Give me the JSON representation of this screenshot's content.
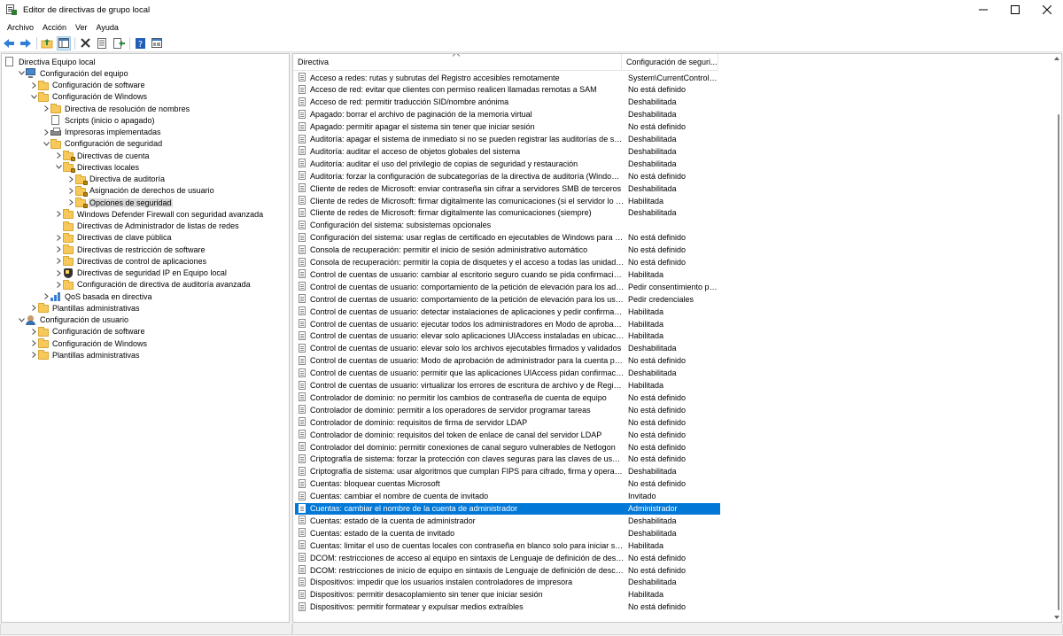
{
  "window": {
    "title": "Editor de directivas de grupo local"
  },
  "menu": [
    "Archivo",
    "Acción",
    "Ver",
    "Ayuda"
  ],
  "toolbar": {
    "icons": [
      "back-arrow-icon",
      "forward-arrow-icon",
      "up-folder-icon",
      "show-hide-tree-icon",
      "delete-icon",
      "properties-icon",
      "export-list-icon",
      "help-icon",
      "console-view-icon"
    ]
  },
  "tree": [
    {
      "label": "Directiva Equipo local",
      "indent": 0,
      "arrow": "",
      "icon": "doc"
    },
    {
      "label": "Configuración del equipo",
      "indent": 1,
      "arrow": "open",
      "icon": "computer"
    },
    {
      "label": "Configuración de software",
      "indent": 2,
      "arrow": "closed",
      "icon": "folder"
    },
    {
      "label": "Configuración de Windows",
      "indent": 2,
      "arrow": "open",
      "icon": "folder"
    },
    {
      "label": "Directiva de resolución de nombres",
      "indent": 3,
      "arrow": "closed",
      "icon": "folder"
    },
    {
      "label": "Scripts (inicio o apagado)",
      "indent": 3,
      "arrow": "",
      "icon": "doc"
    },
    {
      "label": "Impresoras implementadas",
      "indent": 3,
      "arrow": "closed",
      "icon": "printer"
    },
    {
      "label": "Configuración de seguridad",
      "indent": 3,
      "arrow": "open",
      "icon": "folder"
    },
    {
      "label": "Directivas de cuenta",
      "indent": 4,
      "arrow": "closed",
      "icon": "folder-lock"
    },
    {
      "label": "Directivas locales",
      "indent": 4,
      "arrow": "open",
      "icon": "folder-lock"
    },
    {
      "label": "Directiva de auditoría",
      "indent": 5,
      "arrow": "closed",
      "icon": "folder-lock"
    },
    {
      "label": "Asignación de derechos de usuario",
      "indent": 5,
      "arrow": "closed",
      "icon": "folder-lock"
    },
    {
      "label": "Opciones de seguridad",
      "indent": 5,
      "arrow": "closed",
      "icon": "folder-lock",
      "selected": true
    },
    {
      "label": "Windows Defender Firewall con seguridad avanzada",
      "indent": 4,
      "arrow": "closed",
      "icon": "folder"
    },
    {
      "label": "Directivas de Administrador de listas de redes",
      "indent": 4,
      "arrow": "",
      "icon": "folder"
    },
    {
      "label": "Directivas de clave pública",
      "indent": 4,
      "arrow": "closed",
      "icon": "folder"
    },
    {
      "label": "Directivas de restricción de software",
      "indent": 4,
      "arrow": "closed",
      "icon": "folder"
    },
    {
      "label": "Directivas de control de aplicaciones",
      "indent": 4,
      "arrow": "closed",
      "icon": "folder"
    },
    {
      "label": "Directivas de seguridad IP en Equipo local",
      "indent": 4,
      "arrow": "closed",
      "icon": "shield"
    },
    {
      "label": "Configuración de directiva de auditoría avanzada",
      "indent": 4,
      "arrow": "closed",
      "icon": "folder"
    },
    {
      "label": "QoS basada en directiva",
      "indent": 3,
      "arrow": "closed",
      "icon": "chart"
    },
    {
      "label": "Plantillas administrativas",
      "indent": 2,
      "arrow": "closed",
      "icon": "folder"
    },
    {
      "label": "Configuración de usuario",
      "indent": 1,
      "arrow": "open",
      "icon": "user"
    },
    {
      "label": "Configuración de software",
      "indent": 2,
      "arrow": "closed",
      "icon": "folder"
    },
    {
      "label": "Configuración de Windows",
      "indent": 2,
      "arrow": "closed",
      "icon": "folder"
    },
    {
      "label": "Plantillas administrativas",
      "indent": 2,
      "arrow": "closed",
      "icon": "folder"
    }
  ],
  "list": {
    "columns": [
      "Directiva",
      "Configuración de seguri..."
    ],
    "rows": [
      {
        "policy": "Acceso a redes: rutas y subrutas del Registro accesibles remotamente",
        "setting": "System\\CurrentControlS..."
      },
      {
        "policy": "Acceso de red: evitar que clientes con permiso realicen llamadas remotas a SAM",
        "setting": "No está definido"
      },
      {
        "policy": "Acceso de red: permitir traducción SID/nombre anónima",
        "setting": "Deshabilitada"
      },
      {
        "policy": "Apagado: borrar el archivo de paginación de la memoria virtual",
        "setting": "Deshabilitada"
      },
      {
        "policy": "Apagado: permitir apagar el sistema sin tener que iniciar sesión",
        "setting": "No está definido"
      },
      {
        "policy": "Auditoría: apagar el sistema de inmediato si no se pueden registrar las auditorías de seguri...",
        "setting": "Deshabilitada"
      },
      {
        "policy": "Auditoría: auditar el acceso de objetos globales del sistema",
        "setting": "Deshabilitada"
      },
      {
        "policy": "Auditoría: auditar el uso del privilegio de copias de seguridad y restauración",
        "setting": "Deshabilitada"
      },
      {
        "policy": "Auditoría: forzar la configuración de subcategorías de la directiva de auditoría (Windows V...",
        "setting": "No está definido"
      },
      {
        "policy": "Cliente de redes de Microsoft: enviar contraseña sin cifrar a servidores SMB de terceros",
        "setting": "Deshabilitada"
      },
      {
        "policy": "Cliente de redes de Microsoft: firmar digitalmente las comunicaciones (si el servidor lo per...",
        "setting": "Habilitada"
      },
      {
        "policy": "Cliente de redes de Microsoft: firmar digitalmente las comunicaciones (siempre)",
        "setting": "Deshabilitada"
      },
      {
        "policy": "Configuración del sistema: subsistemas opcionales",
        "setting": ""
      },
      {
        "policy": "Configuración del sistema: usar reglas de certificado en ejecutables de Windows para dire...",
        "setting": "No está definido"
      },
      {
        "policy": "Consola de recuperación: permitir el inicio de sesión administrativo automático",
        "setting": "No está definido"
      },
      {
        "policy": "Consola de recuperación: permitir la copia de disquetes y el acceso a todas las unidades y ...",
        "setting": "No está definido"
      },
      {
        "policy": "Control de cuentas de usuario: cambiar al escritorio seguro cuando se pida confirmación ...",
        "setting": "Habilitada"
      },
      {
        "policy": "Control de cuentas de usuario: comportamiento de la petición de elevación para los admi...",
        "setting": "Pedir consentimiento pa..."
      },
      {
        "policy": "Control de cuentas de usuario: comportamiento de la petición de elevación para los usuar...",
        "setting": "Pedir credenciales"
      },
      {
        "policy": "Control de cuentas de usuario: detectar instalaciones de aplicaciones y pedir confirmació...",
        "setting": "Habilitada"
      },
      {
        "policy": "Control de cuentas de usuario: ejecutar todos los administradores en Modo de aprobació...",
        "setting": "Habilitada"
      },
      {
        "policy": "Control de cuentas de usuario: elevar solo aplicaciones UIAccess instaladas en ubicacione...",
        "setting": "Habilitada"
      },
      {
        "policy": "Control de cuentas de usuario: elevar solo los archivos ejecutables firmados y validados",
        "setting": "Deshabilitada"
      },
      {
        "policy": "Control de cuentas de usuario: Modo de aprobación de administrador para la cuenta pred...",
        "setting": "No está definido"
      },
      {
        "policy": "Control de cuentas de usuario: permitir que las aplicaciones UIAccess pidan confirmación ...",
        "setting": "Deshabilitada"
      },
      {
        "policy": "Control de cuentas de usuario: virtualizar los errores de escritura de archivo y de Registro e...",
        "setting": "Habilitada"
      },
      {
        "policy": "Controlador de dominio: no permitir los cambios de contraseña de cuenta de equipo",
        "setting": "No está definido"
      },
      {
        "policy": "Controlador de dominio: permitir a los operadores de servidor programar tareas",
        "setting": "No está definido"
      },
      {
        "policy": "Controlador de dominio: requisitos de firma de servidor LDAP",
        "setting": "No está definido"
      },
      {
        "policy": "Controlador de dominio: requisitos del token de enlace de canal del servidor LDAP",
        "setting": "No está definido"
      },
      {
        "policy": "Controlador del dominio: permitir conexiones de canal seguro vulnerables de Netlogon",
        "setting": "No está definido"
      },
      {
        "policy": "Criptografía de sistema: forzar la protección con claves seguras para las claves de usuario ...",
        "setting": "No está definido"
      },
      {
        "policy": "Criptografía de sistema: usar algoritmos que cumplan FIPS para cifrado, firma y operacion...",
        "setting": "Deshabilitada"
      },
      {
        "policy": "Cuentas: bloquear cuentas Microsoft",
        "setting": "No está definido"
      },
      {
        "policy": "Cuentas: cambiar el nombre de cuenta de invitado",
        "setting": "Invitado"
      },
      {
        "policy": "Cuentas: cambiar el nombre de la cuenta de administrador",
        "setting": "Administrador",
        "selected": true
      },
      {
        "policy": "Cuentas: estado de la cuenta de administrador",
        "setting": "Deshabilitada"
      },
      {
        "policy": "Cuentas: estado de la cuenta de invitado",
        "setting": "Deshabilitada"
      },
      {
        "policy": "Cuentas: limitar el uso de cuentas locales con contraseña en blanco solo para iniciar sesió...",
        "setting": "Habilitada"
      },
      {
        "policy": "DCOM: restricciones de acceso al equipo en sintaxis de Lenguaje de definición de descript...",
        "setting": "No está definido"
      },
      {
        "policy": "DCOM: restricciones de inicio de equipo en sintaxis de Lenguaje de definición de descript...",
        "setting": "No está definido"
      },
      {
        "policy": "Dispositivos: impedir que los usuarios instalen controladores de impresora",
        "setting": "Deshabilitada"
      },
      {
        "policy": "Dispositivos: permitir desacoplamiento sin tener que iniciar sesión",
        "setting": "Habilitada"
      },
      {
        "policy": "Dispositivos: permitir formatear y expulsar medios extraíbles",
        "setting": "No está definido"
      }
    ]
  }
}
